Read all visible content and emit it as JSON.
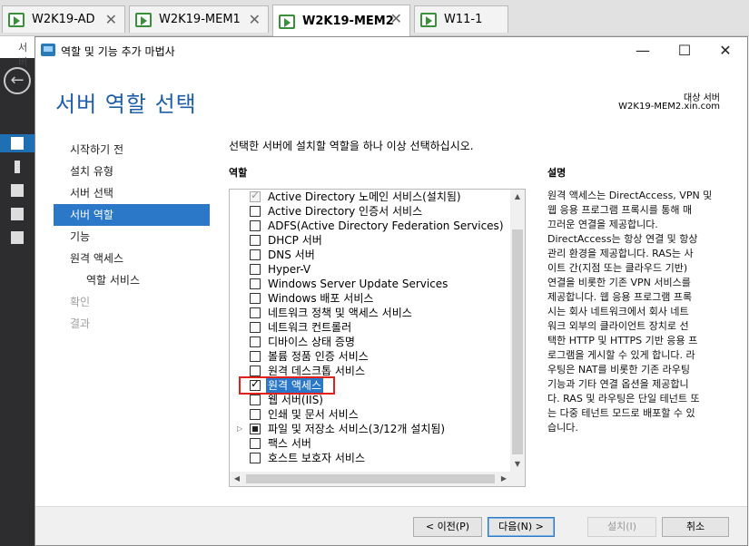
{
  "vm_tabs": [
    {
      "label": "W2K19-AD",
      "active": false
    },
    {
      "label": "W2K19-MEM1",
      "active": false
    },
    {
      "label": "W2K19-MEM2",
      "active": true
    },
    {
      "label": "W11-1",
      "active": false
    }
  ],
  "background": {
    "title_fragment": "서버"
  },
  "window": {
    "title": "역할 및 기능 추가 마법사",
    "minimize": "—",
    "maximize": "☐",
    "close": "✕"
  },
  "header": {
    "page_title": "서버 역할 선택",
    "dest_label": "대상 서버",
    "dest_server": "W2K19-MEM2.xin.com"
  },
  "steps": [
    {
      "label": "시작하기 전",
      "state": "normal"
    },
    {
      "label": "설치 유형",
      "state": "normal"
    },
    {
      "label": "서버 선택",
      "state": "normal"
    },
    {
      "label": "서버 역할",
      "state": "selected"
    },
    {
      "label": "기능",
      "state": "normal"
    },
    {
      "label": "원격 액세스",
      "state": "normal"
    },
    {
      "label": "역할 서비스",
      "state": "sub"
    },
    {
      "label": "확인",
      "state": "disabled"
    },
    {
      "label": "결과",
      "state": "disabled"
    }
  ],
  "instruction": "선택한 서버에 설치할 역할을 하나 이상 선택하십시오.",
  "roles_heading": "역할",
  "roles": [
    {
      "label": "Active Directory 노메인 서비스(설치됨)",
      "checked": true,
      "disabled": true
    },
    {
      "label": "Active Directory 인증서 서비스",
      "checked": false
    },
    {
      "label": "ADFS(Active Directory Federation Services)",
      "checked": false
    },
    {
      "label": "DHCP 서버",
      "checked": false
    },
    {
      "label": "DNS 서버",
      "checked": false
    },
    {
      "label": "Hyper-V",
      "checked": false
    },
    {
      "label": "Windows Server Update Services",
      "checked": false
    },
    {
      "label": "Windows 배포 서비스",
      "checked": false
    },
    {
      "label": "네트워크 정책 및 액세스 서비스",
      "checked": false
    },
    {
      "label": "네트워크 컨트롤러",
      "checked": false
    },
    {
      "label": "디바이스 상태 증명",
      "checked": false
    },
    {
      "label": "볼륨 정품 인증 서비스",
      "checked": false
    },
    {
      "label": "원격 데스크톱 서비스",
      "checked": false
    },
    {
      "label": "원격 액세스",
      "checked": true,
      "highlighted": true
    },
    {
      "label": "웹 서버(IIS)",
      "checked": false
    },
    {
      "label": "인쇄 및 문서 서비스",
      "checked": false
    },
    {
      "label": "파일 및 저장소 서비스(3/12개 설치됨)",
      "checked": "partial",
      "expandable": true
    },
    {
      "label": "팩스 서버",
      "checked": false
    },
    {
      "label": "호스트 보호자 서비스",
      "checked": false
    }
  ],
  "description_heading": "설명",
  "description": "원격 액세스는 DirectAccess, VPN 및\n웹 응용 프로그램 프록시를 통해 매\n끄러운 연결을 제공합니다.\nDirectAccess는 항상 연결 및 항상\n관리 환경을 제공합니다. RAS는 사\n이트 간(지점 또는 클라우드 기반)\n연결을 비롯한 기존 VPN 서비스를\n제공합니다. 웹 응용 프로그램 프록\n시는 회사 네트워크에서 회사 네트\n워크 외부의 클라이언트 장치로 선\n택한 HTTP 및 HTTPS 기반 응용 프\n로그램을 게시할 수 있게 합니다. 라\n우팅은 NAT를 비롯한 기존 라우팅\n기능과 기타 연결 옵션을 제공합니\n다. RAS 및 라우팅은 단일 테넌트 또\n는 다중 테넌트 모드로 배포할 수 있\n습니다.",
  "buttons": {
    "previous": "< 이전(P)",
    "next": "다음(N) >",
    "install": "설치(I)",
    "cancel": "취소"
  }
}
